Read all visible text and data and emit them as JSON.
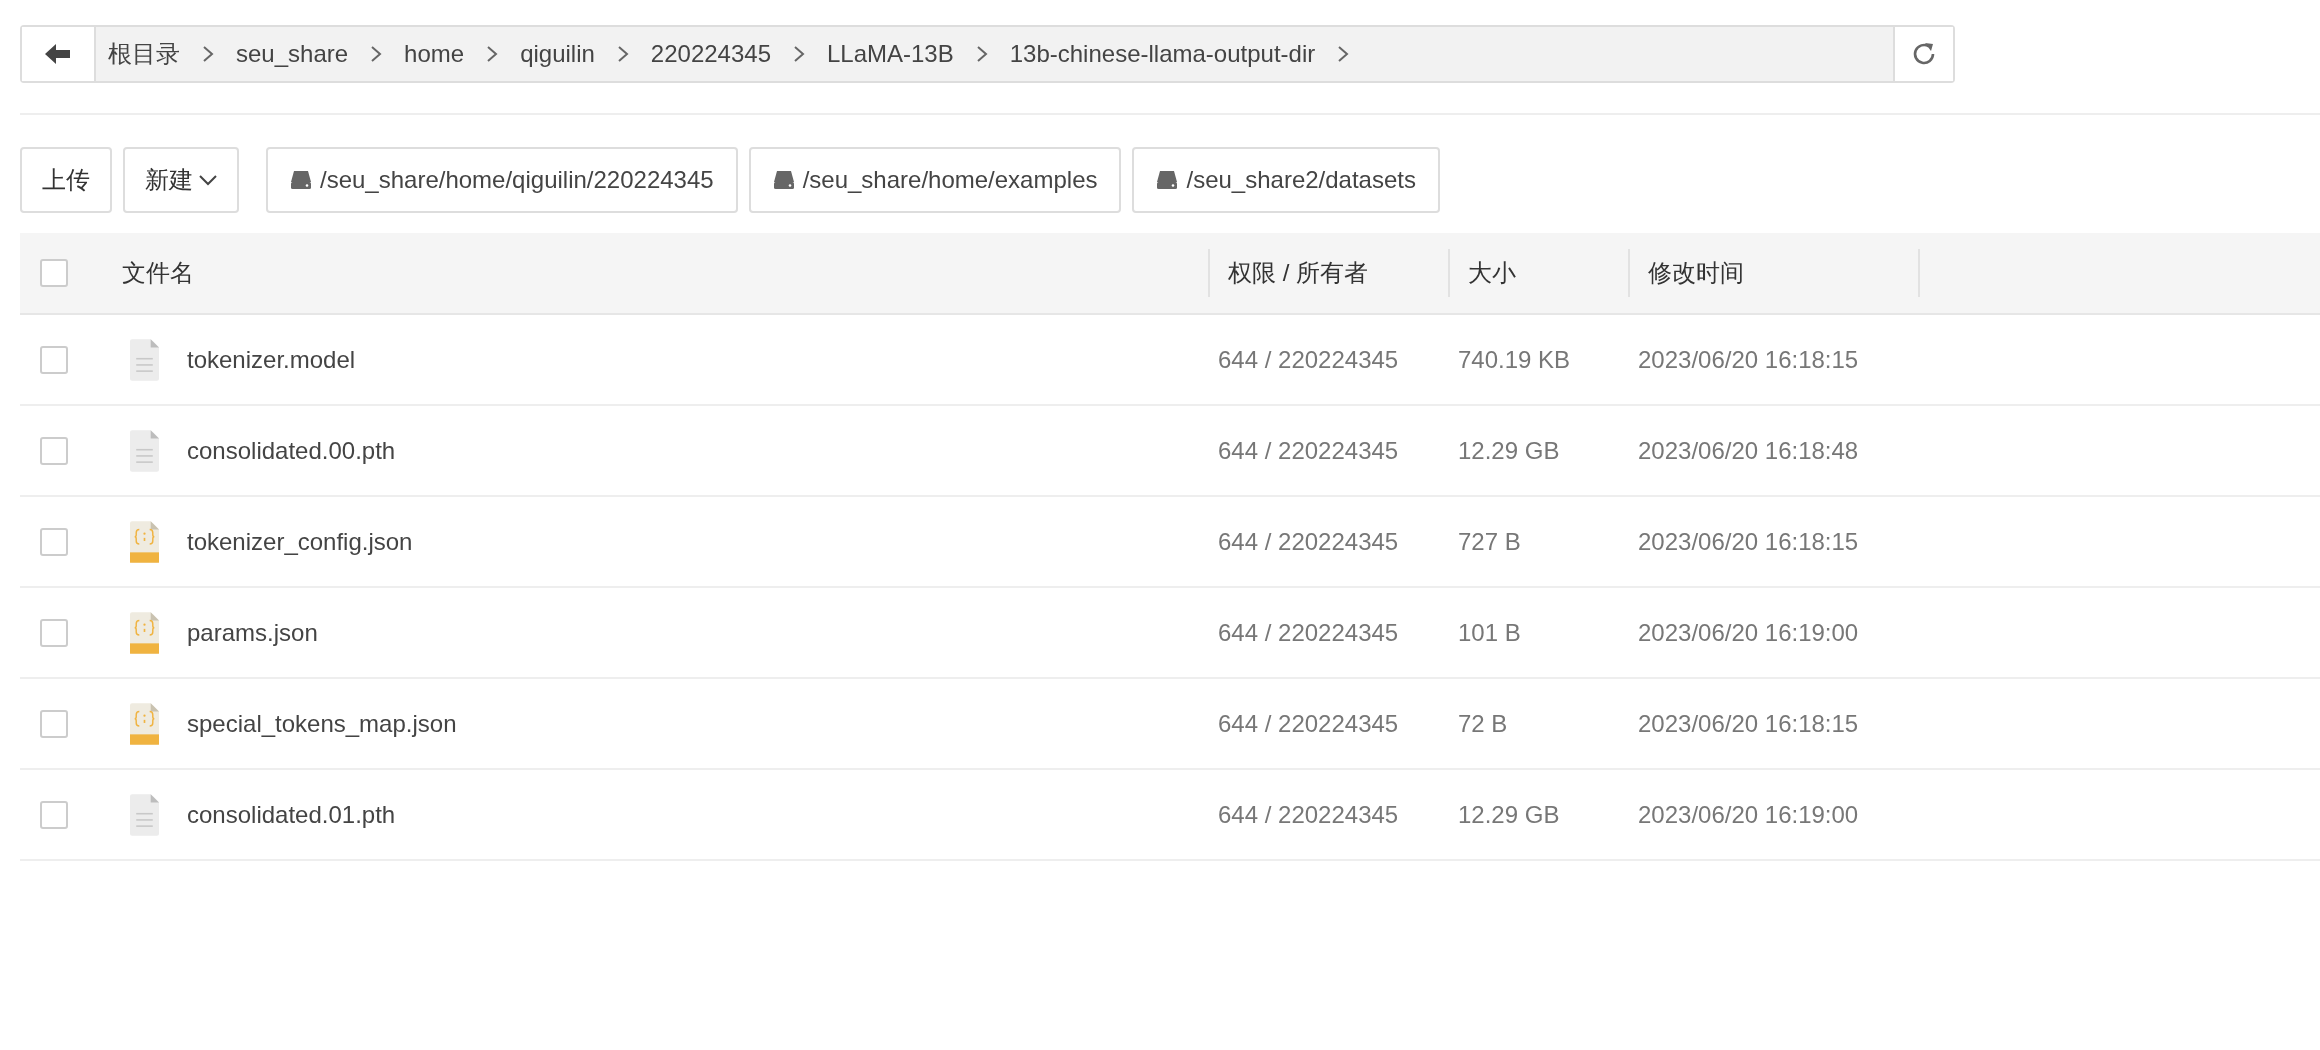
{
  "breadcrumb": {
    "items": [
      "根目录",
      "seu_share",
      "home",
      "qiguilin",
      "220224345",
      "LLaMA-13B",
      "13b-chinese-llama-output-dir"
    ]
  },
  "toolbar": {
    "buttons": [
      {
        "label": "上传",
        "dropdown": false
      },
      {
        "label": "新建",
        "dropdown": true
      }
    ],
    "shortcuts": [
      "/seu_share/home/qiguilin/220224345",
      "/seu_share/home/examples",
      "/seu_share2/datasets"
    ]
  },
  "table": {
    "select_all": {
      "checked": false
    },
    "columns": [
      "文件名",
      "权限 / 所有者",
      "大小",
      "修改时间"
    ],
    "rows": [
      {
        "kind": "file",
        "checked": false,
        "name": "tokenizer.model",
        "owner": "644 / 220224345",
        "size": "740.19 KB",
        "modified": "2023/06/20 16:18:15"
      },
      {
        "kind": "file",
        "checked": false,
        "name": "consolidated.00.pth",
        "owner": "644 / 220224345",
        "size": "12.29 GB",
        "modified": "2023/06/20 16:18:48"
      },
      {
        "kind": "json",
        "checked": false,
        "name": "tokenizer_config.json",
        "owner": "644 / 220224345",
        "size": "727 B",
        "modified": "2023/06/20 16:18:15"
      },
      {
        "kind": "json",
        "checked": false,
        "name": "params.json",
        "owner": "644 / 220224345",
        "size": "101 B",
        "modified": "2023/06/20 16:19:00"
      },
      {
        "kind": "json",
        "checked": false,
        "name": "special_tokens_map.json",
        "owner": "644 / 220224345",
        "size": "72 B",
        "modified": "2023/06/20 16:18:15"
      },
      {
        "kind": "file",
        "checked": false,
        "name": "consolidated.01.pth",
        "owner": "644 / 220224345",
        "size": "12.29 GB",
        "modified": "2023/06/20 16:19:00"
      }
    ]
  }
}
